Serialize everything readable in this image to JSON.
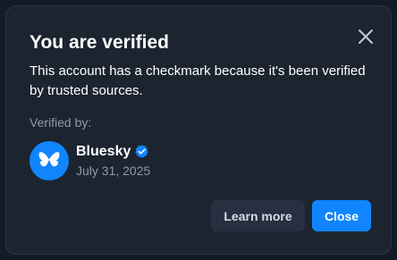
{
  "dialog": {
    "title": "You are verified",
    "description": "This account has a checkmark because it's been verified by trusted sources.",
    "verified_by_label": "Verified by:",
    "verifier": {
      "name": "Bluesky",
      "date": "July 31, 2025",
      "avatar_icon": "butterfly-icon",
      "badge_icon": "verified-check-icon"
    },
    "close_icon": "close-icon",
    "buttons": {
      "learn_more": "Learn more",
      "close": "Close"
    }
  },
  "colors": {
    "accent": "#1185fe",
    "dialog_bg": "#1c2430",
    "muted_text": "#8d9aae",
    "secondary_button_bg": "#263040"
  }
}
